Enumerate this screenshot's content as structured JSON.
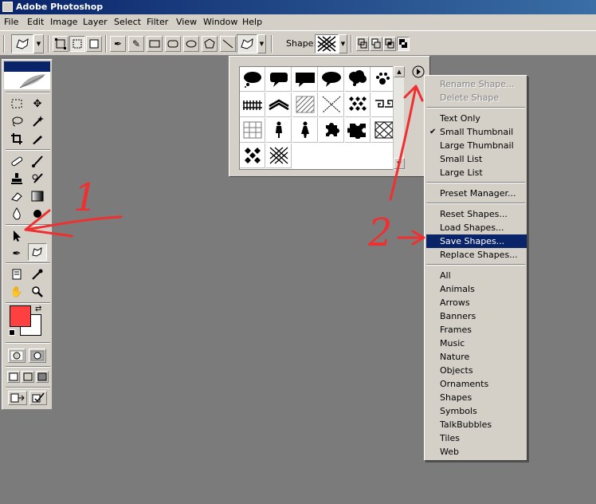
{
  "app": {
    "title": "Adobe Photoshop"
  },
  "menubar": {
    "items": [
      "File",
      "Edit",
      "Image",
      "Layer",
      "Select",
      "Filter",
      "View",
      "Window",
      "Help"
    ]
  },
  "options": {
    "shape_label": "Shape:"
  },
  "shape_menu": {
    "groups": [
      [
        {
          "label": "Rename Shape...",
          "disabled": true
        },
        {
          "label": "Delete Shape",
          "disabled": true
        }
      ],
      [
        {
          "label": "Text Only"
        },
        {
          "label": "Small Thumbnail",
          "checked": true
        },
        {
          "label": "Large Thumbnail"
        },
        {
          "label": "Small List"
        },
        {
          "label": "Large List"
        }
      ],
      [
        {
          "label": "Preset Manager..."
        }
      ],
      [
        {
          "label": "Reset Shapes..."
        },
        {
          "label": "Load Shapes..."
        },
        {
          "label": "Save Shapes...",
          "highlighted": true
        },
        {
          "label": "Replace Shapes..."
        }
      ],
      [
        {
          "label": "All"
        },
        {
          "label": "Animals"
        },
        {
          "label": "Arrows"
        },
        {
          "label": "Banners"
        },
        {
          "label": "Frames"
        },
        {
          "label": "Music"
        },
        {
          "label": "Nature"
        },
        {
          "label": "Objects"
        },
        {
          "label": "Ornaments"
        },
        {
          "label": "Shapes"
        },
        {
          "label": "Symbols"
        },
        {
          "label": "TalkBubbles"
        },
        {
          "label": "Tiles"
        },
        {
          "label": "Web"
        }
      ]
    ]
  },
  "shape_picker": {
    "shapes": [
      "thought-cloud-1",
      "speech-bubble-1",
      "speech-bubble-2",
      "speech-bubble-3",
      "thought-cloud-2",
      "paw-print",
      "fence-grid",
      "zigzag-stripes",
      "diagonal-hatch",
      "x-cross-grid",
      "diamond-tiles",
      "greek-key",
      "square-grid",
      "figure-1",
      "figure-2",
      "puzzle-piece-1",
      "puzzle-piece-2",
      "cross-hatch-tile",
      "diamond-lattice",
      "x-lattice"
    ]
  },
  "annotations": {
    "label_1": "1",
    "label_2": "2",
    "color": "#f03030"
  },
  "colors": {
    "foreground": "#ff4040",
    "background": "#ffffff",
    "title_bar": "#0a246a",
    "workspace": "#7b7b7b"
  }
}
